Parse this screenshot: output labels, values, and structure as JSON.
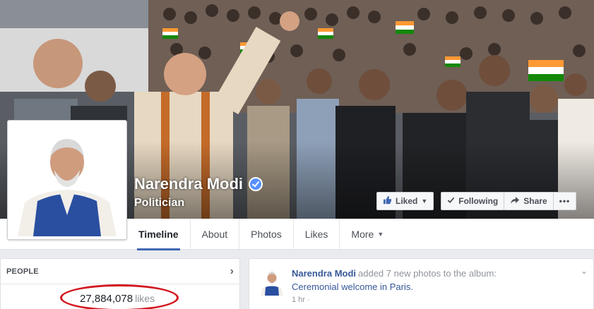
{
  "page": {
    "name": "Narendra Modi",
    "category": "Politician",
    "verified": true
  },
  "actions": {
    "liked_label": "Liked",
    "following_label": "Following",
    "share_label": "Share",
    "more_label": "•••"
  },
  "tabs": [
    {
      "label": "Timeline",
      "active": true
    },
    {
      "label": "About"
    },
    {
      "label": "Photos"
    },
    {
      "label": "Likes"
    },
    {
      "label": "More"
    }
  ],
  "people": {
    "title": "PEOPLE",
    "likes_count": "27,884,078",
    "likes_unit": "likes",
    "annotation_color": "#d2151d"
  },
  "post": {
    "author": "Narendra Modi",
    "action": "added 7 new photos to the album:",
    "album": "Ceremonial welcome in Paris.",
    "time": "1 hr ·"
  },
  "colors": {
    "brand_blue": "#4267b2",
    "link_blue": "#365899",
    "verified_blue": "#5890ff"
  },
  "icons": {
    "verified": "check-badge",
    "liked": "thumbs-up",
    "following": "check",
    "share": "share-arrow",
    "people_chevron": "chevron-right",
    "post_menu": "chevron-down"
  }
}
